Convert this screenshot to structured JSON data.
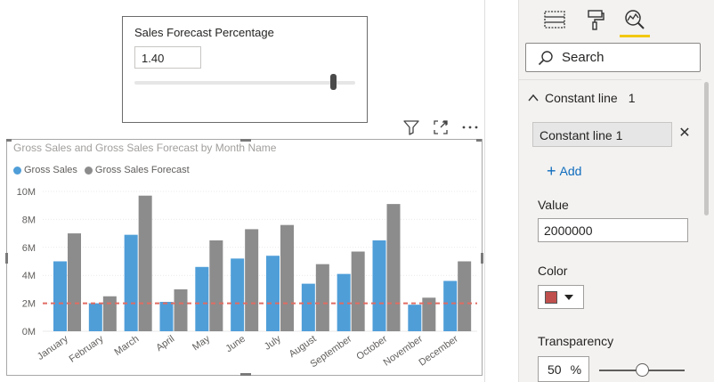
{
  "slicer": {
    "title": "Sales Forecast Percentage",
    "value": "1.40",
    "level": 0.9
  },
  "visual_header": {
    "icons": [
      "filter-icon",
      "focus-mode-icon",
      "more-options-icon"
    ]
  },
  "colors": {
    "gross_sales": "#4f9ed8",
    "gross_sales_forecast": "#8c8c8c",
    "constant_line": "#e06c63",
    "constant_line_swatch": "#c0504d",
    "tab_accent": "#f2c811"
  },
  "chart_data": {
    "type": "bar",
    "title": "Gross Sales and Gross Sales Forecast by Month Name",
    "categories": [
      "January",
      "February",
      "March",
      "April",
      "May",
      "June",
      "July",
      "August",
      "September",
      "October",
      "November",
      "December"
    ],
    "series": [
      {
        "name": "Gross Sales",
        "values": [
          5.0,
          2.0,
          6.9,
          2.1,
          4.6,
          5.2,
          5.4,
          3.4,
          4.1,
          6.5,
          1.9,
          3.6
        ]
      },
      {
        "name": "Gross Sales Forecast",
        "values": [
          7.0,
          2.5,
          9.7,
          3.0,
          6.5,
          7.3,
          7.6,
          4.8,
          5.7,
          9.1,
          2.4,
          5.0
        ]
      }
    ],
    "y_unit": "M",
    "ylim": [
      0,
      10
    ],
    "y_ticks": [
      "0M",
      "2M",
      "4M",
      "6M",
      "8M",
      "10M"
    ],
    "constant_line_value": 2,
    "grid": true,
    "legend_position": "top-left"
  },
  "pane": {
    "tabs": [
      "fields-icon",
      "format-icon",
      "analytics-icon"
    ],
    "active_tab": 2,
    "search_placeholder": "Search",
    "section_title": "Constant line",
    "section_count": "1",
    "item_label": "Constant line 1",
    "add_label": "Add",
    "value_label": "Value",
    "value": "2000000",
    "color_label": "Color",
    "transparency_label": "Transparency",
    "transparency_value": "50",
    "transparency_unit": "%",
    "transparency_level": 0.5
  }
}
